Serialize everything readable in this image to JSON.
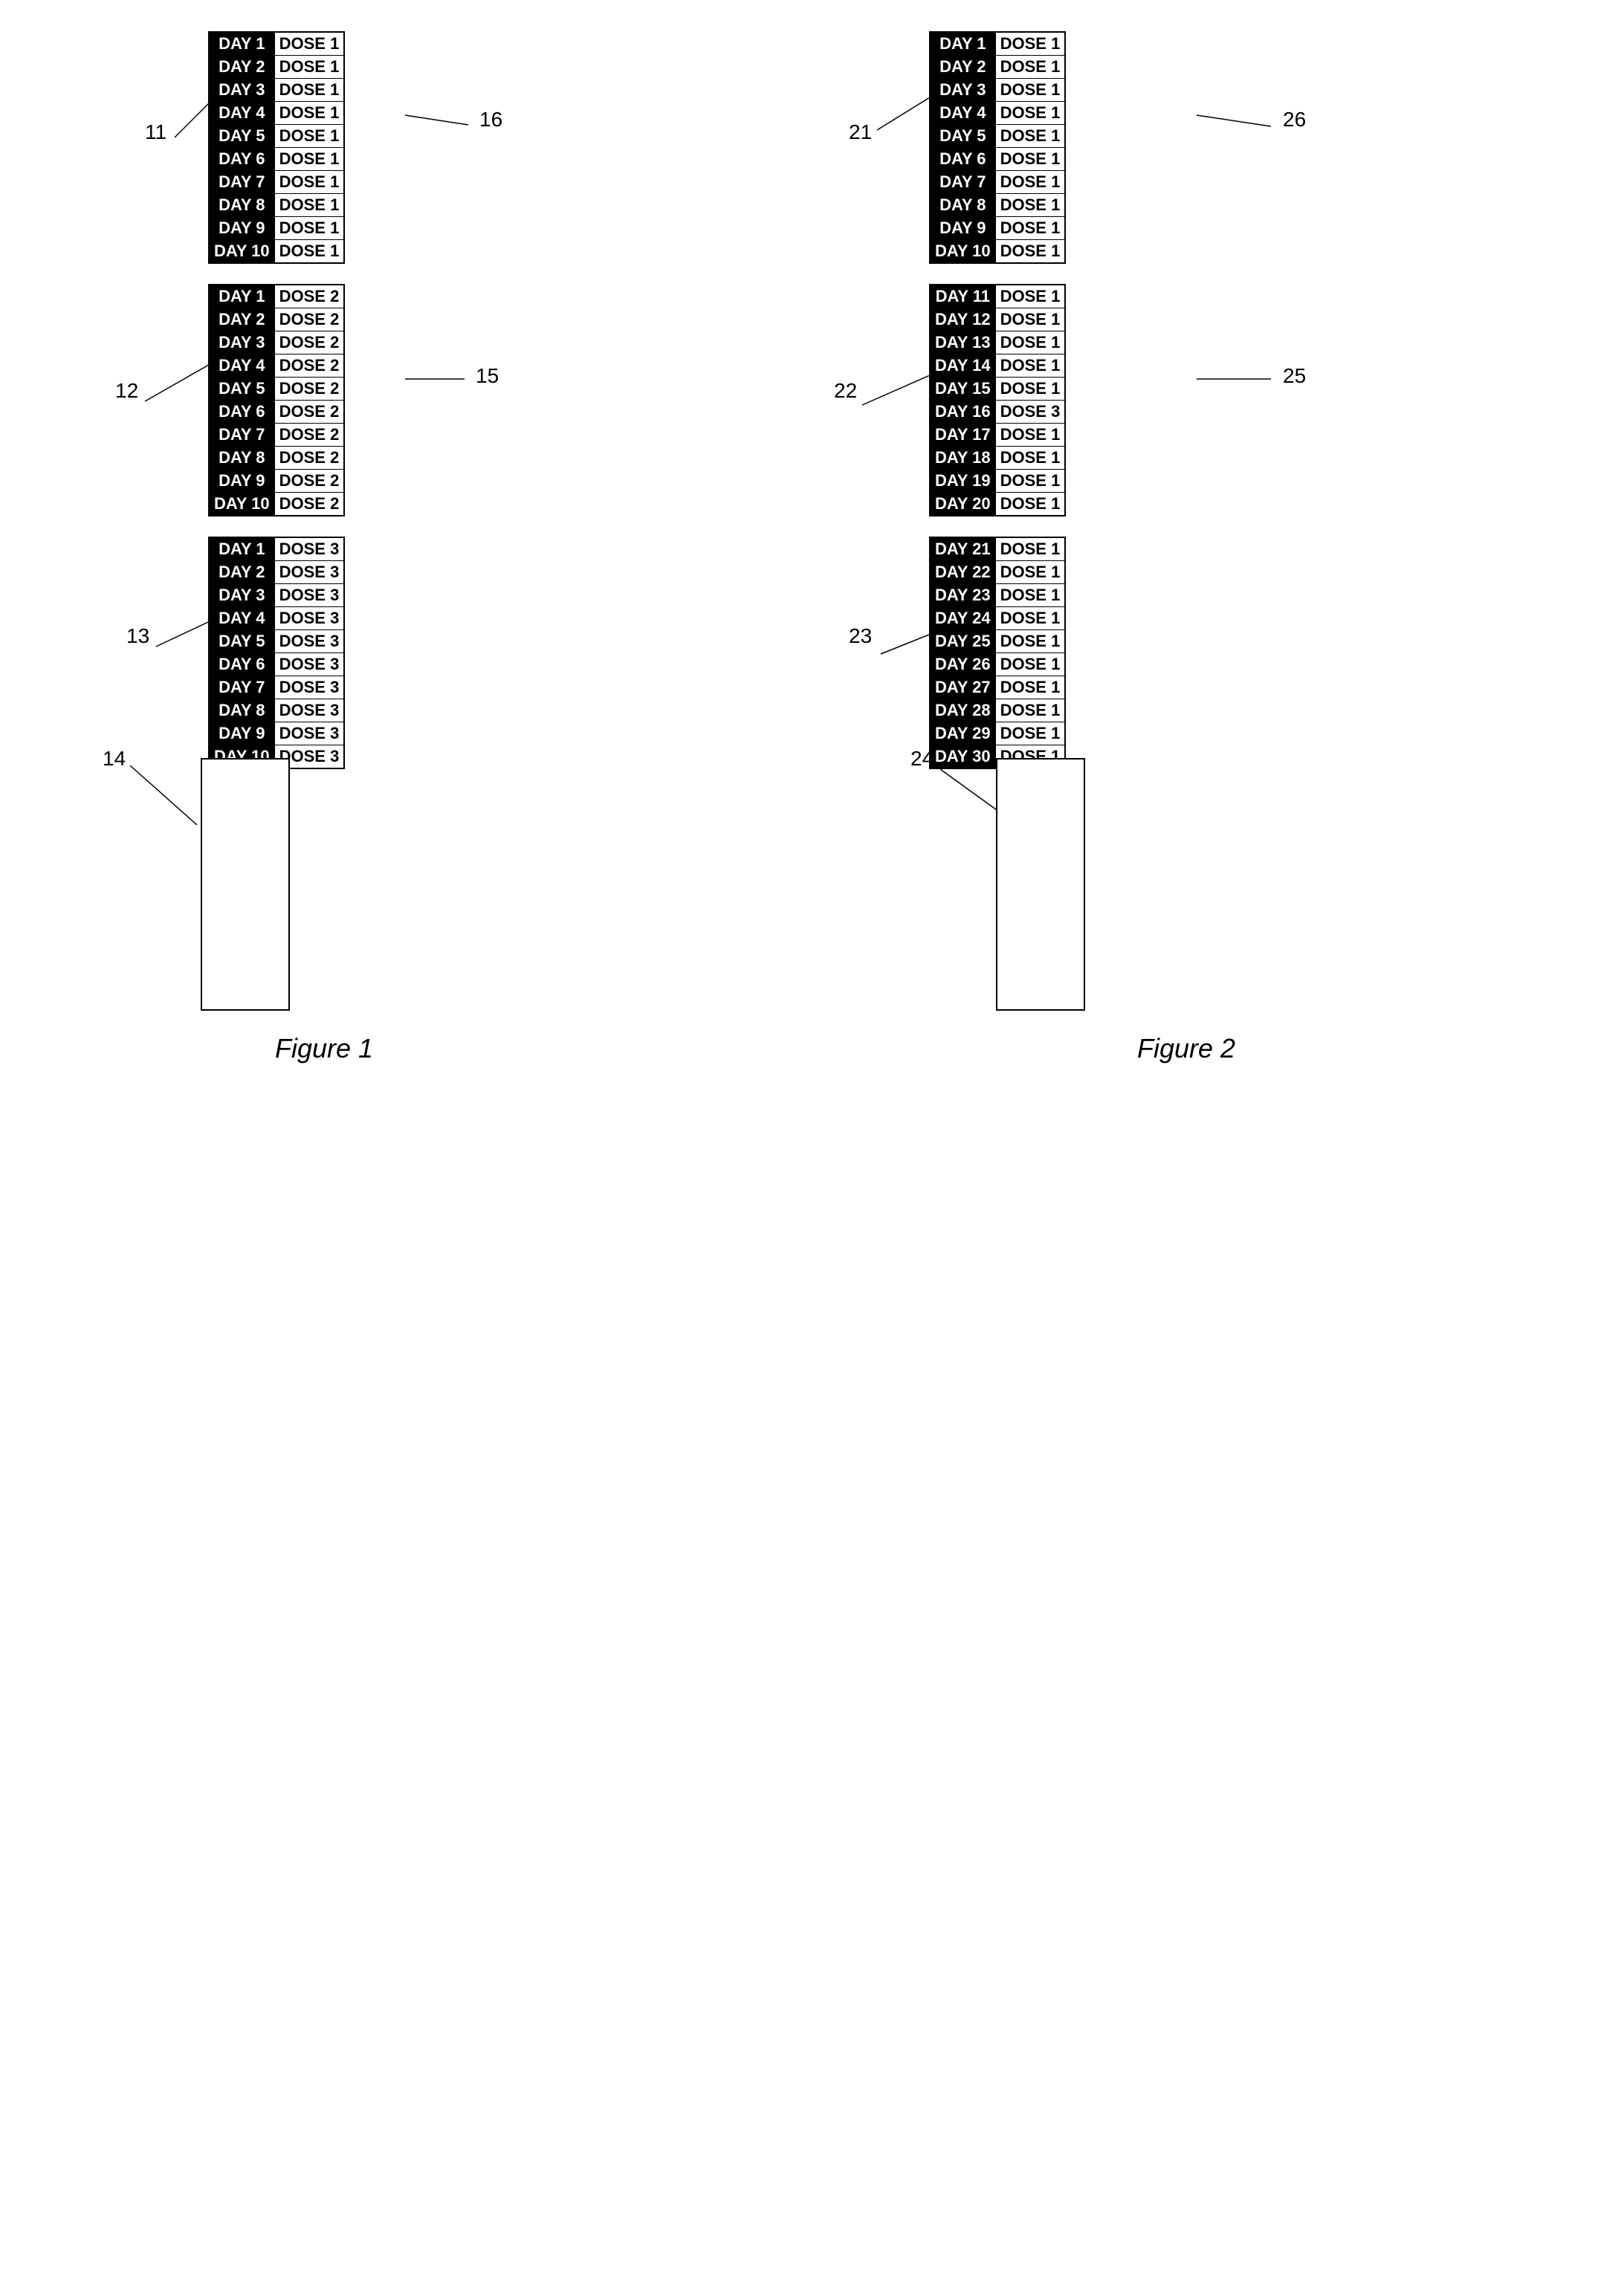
{
  "figures": {
    "figure1_label": "Figure 1",
    "figure2_label": "Figure 2"
  },
  "table11": {
    "label": "11",
    "rows": [
      [
        "DAY 1",
        "DOSE 1"
      ],
      [
        "DAY 2",
        "DOSE 1"
      ],
      [
        "DAY 3",
        "DOSE 1"
      ],
      [
        "DAY 4",
        "DOSE 1"
      ],
      [
        "DAY 5",
        "DOSE 1"
      ],
      [
        "DAY 6",
        "DOSE 1"
      ],
      [
        "DAY 7",
        "DOSE 1"
      ],
      [
        "DAY 8",
        "DOSE 1"
      ],
      [
        "DAY 9",
        "DOSE 1"
      ],
      [
        "DAY 10",
        "DOSE 1"
      ]
    ]
  },
  "table12": {
    "label": "12",
    "rows": [
      [
        "DAY 1",
        "DOSE 2"
      ],
      [
        "DAY 2",
        "DOSE 2"
      ],
      [
        "DAY 3",
        "DOSE 2"
      ],
      [
        "DAY 4",
        "DOSE 2"
      ],
      [
        "DAY 5",
        "DOSE 2"
      ],
      [
        "DAY 6",
        "DOSE 2"
      ],
      [
        "DAY 7",
        "DOSE 2"
      ],
      [
        "DAY 8",
        "DOSE 2"
      ],
      [
        "DAY 9",
        "DOSE 2"
      ],
      [
        "DAY 10",
        "DOSE 2"
      ]
    ]
  },
  "table13": {
    "label": "13",
    "rows": [
      [
        "DAY 1",
        "DOSE 3"
      ],
      [
        "DAY 2",
        "DOSE 3"
      ],
      [
        "DAY 3",
        "DOSE 3"
      ],
      [
        "DAY 4",
        "DOSE 3"
      ],
      [
        "DAY 5",
        "DOSE 3"
      ],
      [
        "DAY 6",
        "DOSE 3"
      ],
      [
        "DAY 7",
        "DOSE 3"
      ],
      [
        "DAY 8",
        "DOSE 3"
      ],
      [
        "DAY 9",
        "DOSE 3"
      ],
      [
        "DAY 10",
        "DOSE 3"
      ]
    ]
  },
  "table14": {
    "label": "14"
  },
  "table21": {
    "label": "21",
    "rows": [
      [
        "DAY 1",
        "DOSE 1"
      ],
      [
        "DAY 2",
        "DOSE 1"
      ],
      [
        "DAY 3",
        "DOSE 1"
      ],
      [
        "DAY 4",
        "DOSE 1"
      ],
      [
        "DAY 5",
        "DOSE 1"
      ],
      [
        "DAY 6",
        "DOSE 1"
      ],
      [
        "DAY 7",
        "DOSE 1"
      ],
      [
        "DAY 8",
        "DOSE 1"
      ],
      [
        "DAY 9",
        "DOSE 1"
      ],
      [
        "DAY 10",
        "DOSE 1"
      ]
    ]
  },
  "table22": {
    "label": "22",
    "rows": [
      [
        "DAY 11",
        "DOSE 1"
      ],
      [
        "DAY 12",
        "DOSE 1"
      ],
      [
        "DAY 13",
        "DOSE 1"
      ],
      [
        "DAY 14",
        "DOSE 1"
      ],
      [
        "DAY 15",
        "DOSE 1"
      ],
      [
        "DAY 16",
        "DOSE 3"
      ],
      [
        "DAY 17",
        "DOSE 1"
      ],
      [
        "DAY 18",
        "DOSE 1"
      ],
      [
        "DAY 19",
        "DOSE 1"
      ],
      [
        "DAY 20",
        "DOSE 1"
      ]
    ]
  },
  "table23": {
    "label": "23",
    "rows": [
      [
        "DAY 21",
        "DOSE 1"
      ],
      [
        "DAY 22",
        "DOSE 1"
      ],
      [
        "DAY 23",
        "DOSE 1"
      ],
      [
        "DAY 24",
        "DOSE 1"
      ],
      [
        "DAY 25",
        "DOSE 1"
      ],
      [
        "DAY 26",
        "DOSE 1"
      ],
      [
        "DAY 27",
        "DOSE 1"
      ],
      [
        "DAY 28",
        "DOSE 1"
      ],
      [
        "DAY 29",
        "DOSE 1"
      ],
      [
        "DAY 30",
        "DOSE 1"
      ]
    ]
  },
  "table24": {
    "label": "24"
  },
  "ref_labels": {
    "r11": "11",
    "r12": "12",
    "r13": "13",
    "r14": "14",
    "r15": "15",
    "r16": "16",
    "r21": "21",
    "r22": "22",
    "r23": "23",
    "r24": "24",
    "r25": "25",
    "r26": "26"
  }
}
